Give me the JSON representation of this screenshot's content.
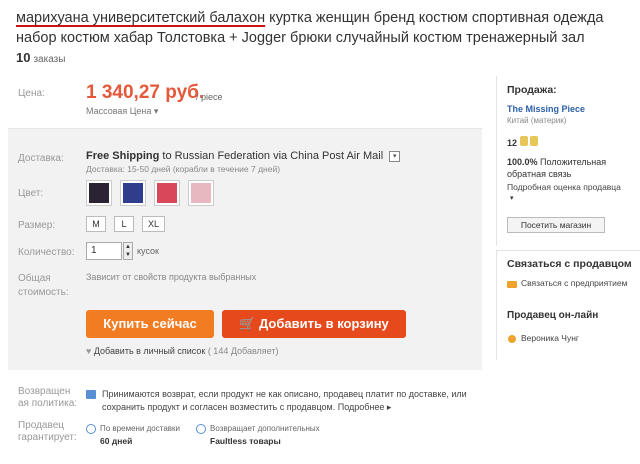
{
  "product": {
    "title_highlight": "марихуана университетский балахон",
    "title_rest": " куртка женщин бренд костюм спортивная одежда набор костюм хабар Толстовка + Jogger брюки случайный костюм тренажерный зал",
    "orders_count": "10",
    "orders_label": "заказы"
  },
  "price": {
    "label": "Цена:",
    "value": "1 340,27 руб.",
    "unit": "/ piece",
    "type": "Массовая Цена ▾"
  },
  "shipping": {
    "label": "Доставка:",
    "free": "Free Shipping",
    "to": "to",
    "destination": "Russian Federation via China Post Air Mail",
    "dropdown": "▾",
    "delivery": "Доставка: 15-50 дней (корабли в течение 7 дней)"
  },
  "color": {
    "label": "Цвет:",
    "swatches": [
      "#2b2233",
      "#2e3d8c",
      "#d9485a",
      "#e7b8c0"
    ]
  },
  "size": {
    "label": "Размер:",
    "options": [
      "M",
      "L",
      "XL"
    ]
  },
  "quantity": {
    "label": "Количество:",
    "value": "1",
    "unit": "кусок"
  },
  "total": {
    "label_1": "Общая",
    "label_2": "стоимость:",
    "value": "Зависит от свойств продукта выбранных"
  },
  "actions": {
    "buy_now": "Купить сейчас",
    "add_cart": "Добавить в корзину",
    "wish_label": "Добавить в личный список",
    "wish_count": "( 144 Добавляет)"
  },
  "returns": {
    "label_1": "Возвращен",
    "label_2": "ая политика:",
    "text": "Принимаются возврат, если продукт не как описано, продавец платит по доставке, или сохранить продукт и согласен возместить с продавцом.",
    "more": "Подробнее ▸"
  },
  "guarantee": {
    "label_1": "Продавец",
    "label_2": "гарантирует:",
    "g1_small": "По времени доставки",
    "g1_big": "60 дней",
    "g2_small": "Возвращает дополнительных",
    "g2_big": "Faultless товары"
  },
  "seller": {
    "heading": "Продажа:",
    "name": "The Missing Piece",
    "location": "Китай (материк)",
    "level": "12",
    "feedback_pct": "100.0%",
    "feedback_text": "Положительная обратная связь",
    "rating_text": "Подробная оценка продавца",
    "arrow": "▾",
    "visit_button": "Посетить магазин"
  },
  "contact": {
    "heading": "Связаться с продавцом",
    "link": "Связаться с предприятием",
    "online_heading": "Продавец он-лайн",
    "online_name": "Вероника Чунг"
  },
  "colors": {
    "price": "#e4593a",
    "buy": "#f27c22",
    "cart": "#e6491c",
    "link": "#2b5fa8"
  }
}
